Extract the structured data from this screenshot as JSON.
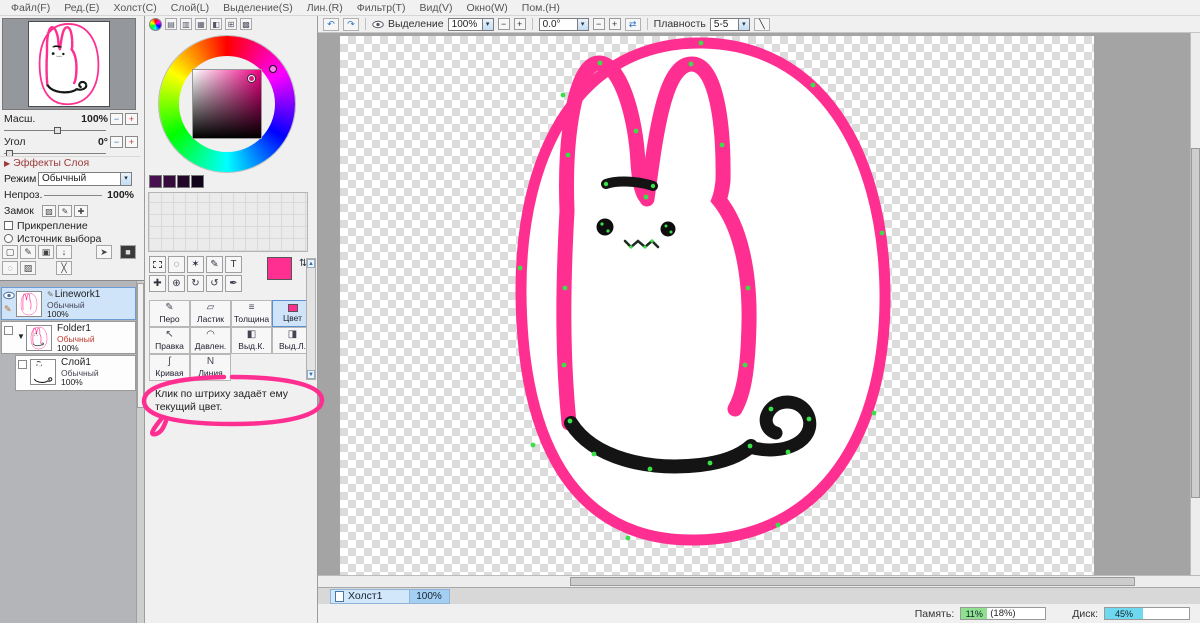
{
  "colors": {
    "accent_pink": "#ff2f92",
    "selection_blue": "#cfe4f8",
    "memory_green": "#8fe08f",
    "disk_cyan": "#6ed9ee",
    "canvas_gray": "#a4a4a4"
  },
  "menu_bar": {
    "items": [
      {
        "label": "Файл(F)"
      },
      {
        "label": "Ред.(E)"
      },
      {
        "label": "Холст(C)"
      },
      {
        "label": "Слой(L)"
      },
      {
        "label": "Выделение(S)"
      },
      {
        "label": "Лин.(R)"
      },
      {
        "label": "Фильтр(T)"
      },
      {
        "label": "Вид(V)"
      },
      {
        "label": "Окно(W)"
      },
      {
        "label": "Пом.(H)"
      }
    ]
  },
  "left_panel": {
    "scale": {
      "label": "Масш.",
      "value": "100%"
    },
    "angle": {
      "label": "Угол",
      "value": "0°"
    },
    "layer_effects_label": "Эффекты Слоя",
    "mode": {
      "label": "Режим",
      "value": "Обычный"
    },
    "opacity": {
      "label": "Непроз.",
      "value": "100%"
    },
    "lock_label": "Замок",
    "attach_label": "Прикрепление",
    "selection_source_label": "Источник выбора",
    "layers": [
      {
        "name": "Linework1",
        "mode": "Обычный",
        "opacity": "100%"
      },
      {
        "name": "Folder1",
        "mode": "Обычный",
        "opacity": "100%"
      },
      {
        "name": "Слой1",
        "mode": "Обычный",
        "opacity": "100%"
      }
    ]
  },
  "color_panel": {
    "swatches": [
      "#47104e",
      "#350b3c",
      "#22062a",
      "#100218"
    ]
  },
  "tool_panel": {
    "options": [
      {
        "label": "Перо"
      },
      {
        "label": "Ластик"
      },
      {
        "label": "Толщина"
      },
      {
        "label": "Цвет"
      },
      {
        "label": "Правка"
      },
      {
        "label": "Давлен."
      },
      {
        "label": "Выд.К."
      },
      {
        "label": "Выд.Л."
      },
      {
        "label": "Кривая"
      },
      {
        "label": "Линия"
      }
    ],
    "hint": "Клик по штриху задаёт ему текущий цвет."
  },
  "canvas_area": {
    "toolbar": {
      "selection_label": "Выделение",
      "zoom_value": "100%",
      "angle_value": "0.0°",
      "smooth_label": "Плавность",
      "smooth_value": "5-5"
    },
    "tab": {
      "name": "Холст1",
      "zoom": "100%"
    }
  },
  "status_bar": {
    "memory_label": "Память:",
    "memory_percent": "11%",
    "memory_extra": "(18%)",
    "disk_label": "Диск:",
    "disk_percent": "45%"
  }
}
